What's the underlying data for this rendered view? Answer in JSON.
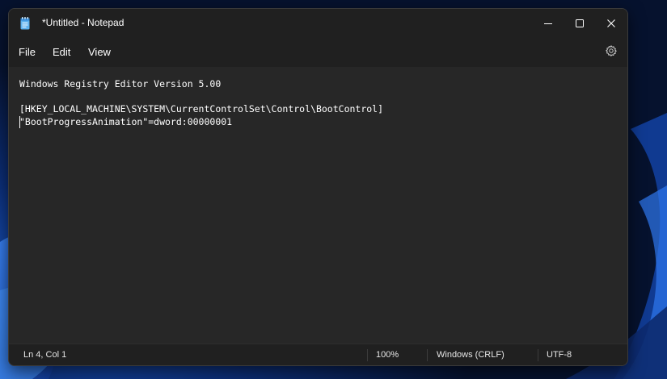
{
  "window": {
    "title": "*Untitled - Notepad"
  },
  "menu": {
    "file": "File",
    "edit": "Edit",
    "view": "View"
  },
  "editor": {
    "lines": [
      "Windows Registry Editor Version 5.00",
      "",
      "[HKEY_LOCAL_MACHINE\\SYSTEM\\CurrentControlSet\\Control\\BootControl]",
      "\"BootProgressAnimation\"=dword:00000001"
    ]
  },
  "status": {
    "position": "Ln 4, Col 1",
    "zoom": "100%",
    "line_ending": "Windows (CRLF)",
    "encoding": "UTF-8"
  },
  "icons": {
    "app": "notepad-icon",
    "minimize": "minimize-icon",
    "maximize": "maximize-icon",
    "close": "close-icon",
    "settings": "gear-icon"
  },
  "colors": {
    "editor_bg": "#272727",
    "chrome_bg": "#202020",
    "text": "#ffffff",
    "wallpaper_accent": "#1f5fd6"
  }
}
